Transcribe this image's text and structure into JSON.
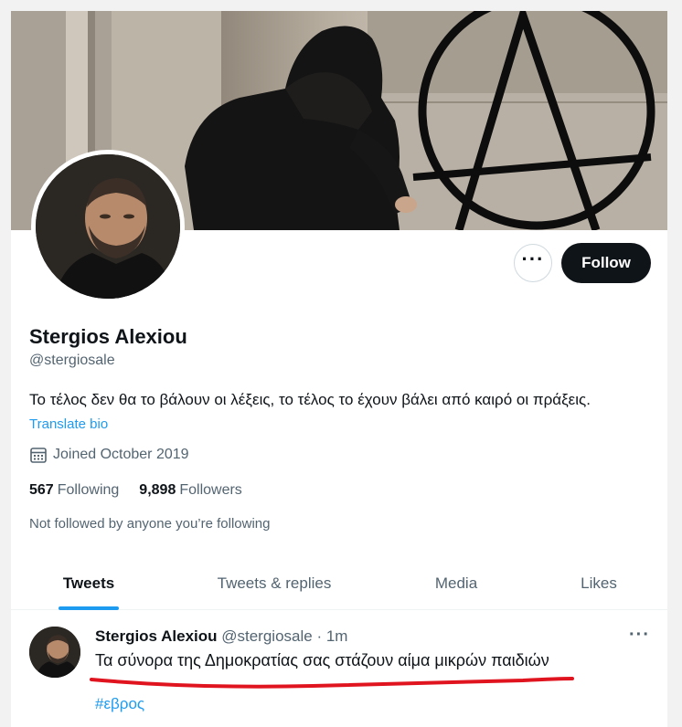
{
  "profile": {
    "name": "Stergios Alexiou",
    "handle": "@stergiosale",
    "bio": "Το τέλος δεν θα το βάλουν οι λέξεις, το τέλος το έχουν βάλει από καιρό οι πράξεις.",
    "translate_label": "Translate bio",
    "joined": "Joined October 2019",
    "following_count": "567",
    "following_label": "Following",
    "followers_count": "9,898",
    "followers_label": "Followers",
    "not_followed": "Not followed by anyone you’re following"
  },
  "actions": {
    "more_label": "···",
    "follow_label": "Follow"
  },
  "tabs": [
    {
      "label": "Tweets",
      "active": true
    },
    {
      "label": "Tweets & replies",
      "active": false
    },
    {
      "label": "Media",
      "active": false
    },
    {
      "label": "Likes",
      "active": false
    }
  ],
  "tweet": {
    "name": "Stergios Alexiou",
    "meta": "@stergiosale · 1m",
    "text": "Τα σύνορα της Δημοκρατίας σας στάζουν αίμα μικρών παιδιών",
    "hashtag": "#εβρος",
    "more_label": "···"
  },
  "colors": {
    "accent": "#1d9bf0",
    "text": "#0f1419",
    "secondary": "#536471",
    "annotation": "#e0141e"
  },
  "icons": [
    "more-icon",
    "calendar-icon"
  ]
}
